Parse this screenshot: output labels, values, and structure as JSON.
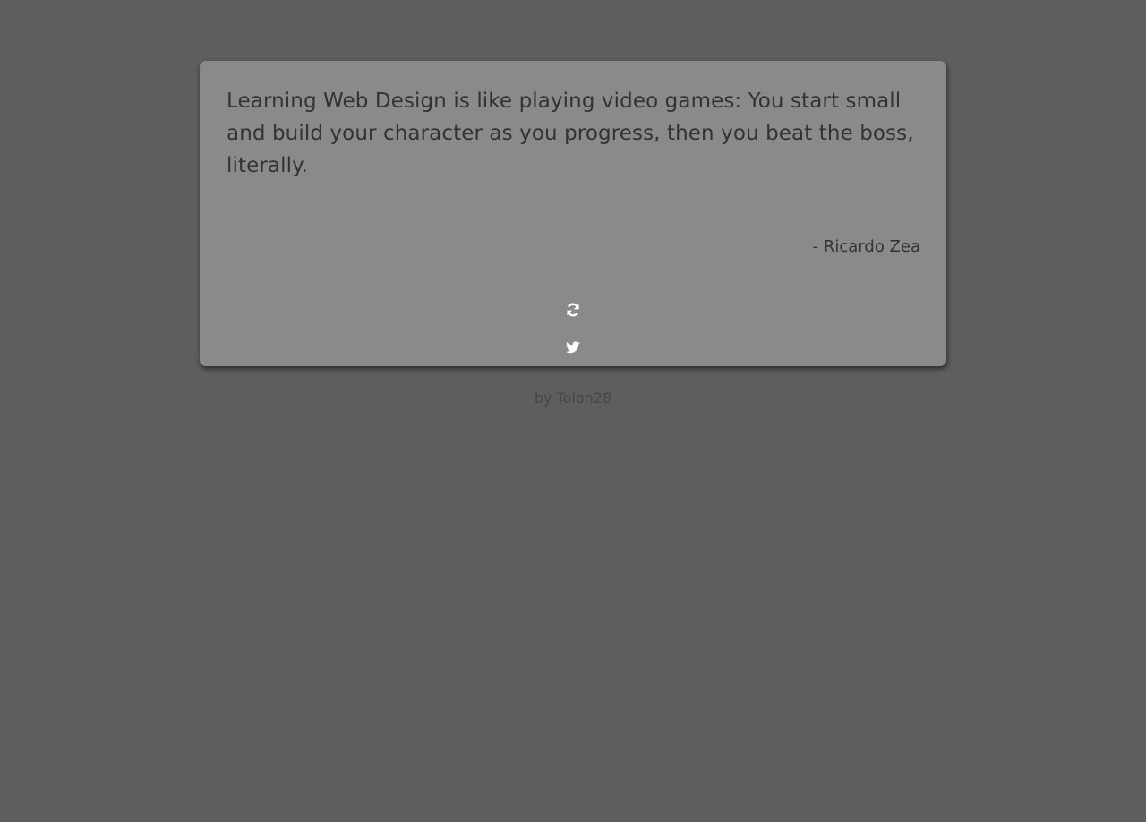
{
  "quote": {
    "text": "Learning Web Design is like playing video games: You start small and build your character as you progress, then you beat the boss, literally.",
    "author": "- Ricardo Zea"
  },
  "actions": {
    "new_quote_icon": "refresh-icon",
    "tweet_icon": "twitter-icon"
  },
  "footer": {
    "credit": "by Tolon28"
  },
  "colors": {
    "page_background": "#5e5e5e",
    "card_background": "#8a8a8a",
    "quote_text": "#333333",
    "icon": "#ffffff",
    "credit_text": "#474747"
  }
}
